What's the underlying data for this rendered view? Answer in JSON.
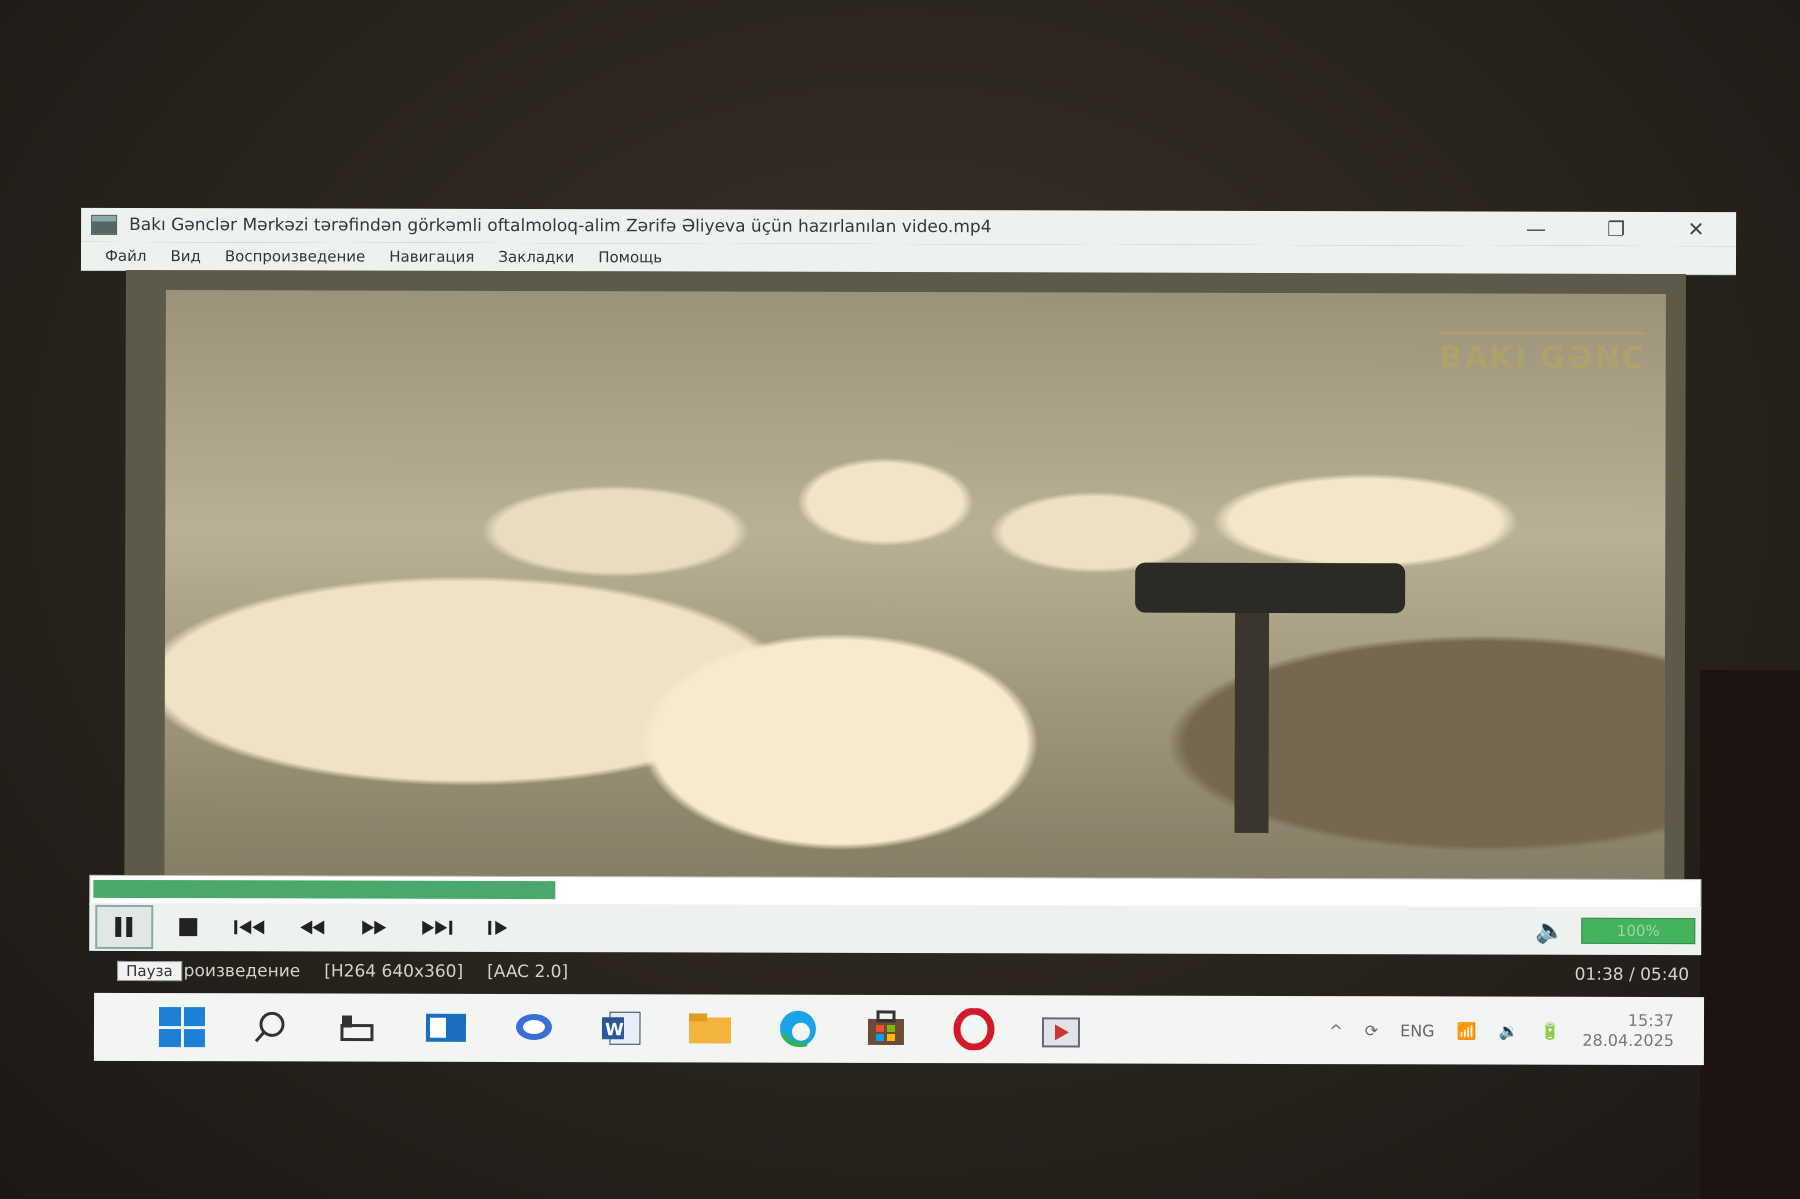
{
  "window": {
    "title": "Bakı Gənclər Mərkəzi tərəfindən görkəmli oftalmoloq-alim Zərifə Əliyeva üçün hazırlanılan video.mp4",
    "minimize_glyph": "—",
    "maximize_glyph": "❐",
    "close_glyph": "✕"
  },
  "menu": [
    "Файл",
    "Вид",
    "Воспроизведение",
    "Навигация",
    "Закладки",
    "Помощь"
  ],
  "video": {
    "watermark": "BAKI GƏNC"
  },
  "playback": {
    "progress": 0.288,
    "volume_label": "100%"
  },
  "controls": {
    "pause_icon": "pause-icon",
    "stop_icon": "stop-icon",
    "prev_icon": "skip-back-icon",
    "rewind_icon": "rewind-icon",
    "forward_icon": "fast-forward-icon",
    "next_icon": "skip-forward-icon",
    "frame_icon": "frame-step-icon"
  },
  "status": {
    "tooltip": "Пауза",
    "state": "роизведение",
    "video_codec": "[H264 640x360]",
    "audio_codec": "[AAC 2.0]",
    "time": "01:38 / 05:40"
  },
  "taskbar": {
    "tray_lang": "ENG",
    "clock_time": "15:37",
    "clock_date": "28.04.2025"
  }
}
